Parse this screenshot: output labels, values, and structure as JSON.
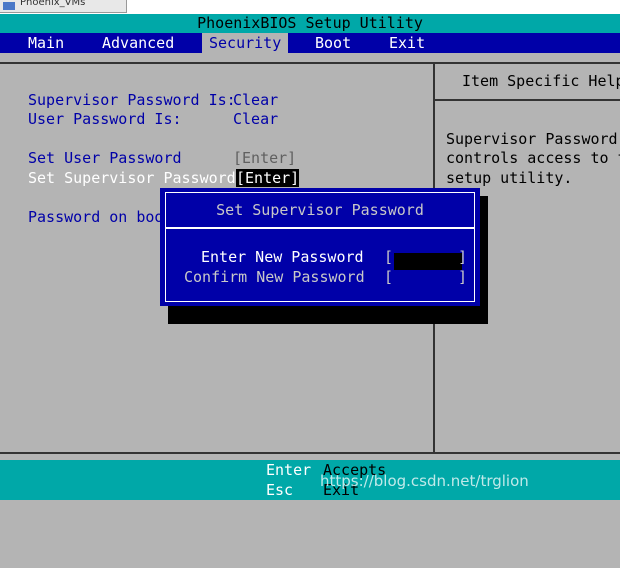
{
  "window": {
    "tab_title": "Phoenix_VMs"
  },
  "title": "PhoenixBIOS Setup Utility",
  "menu": [
    {
      "label": "Main"
    },
    {
      "label": "Advanced"
    },
    {
      "label": "Security",
      "active": true
    },
    {
      "label": "Boot"
    },
    {
      "label": "Exit"
    }
  ],
  "security": {
    "supervisor_pw_label": "Supervisor Password Is:",
    "supervisor_pw_value": "Clear",
    "user_pw_label": "User Password Is:",
    "user_pw_value": "Clear",
    "set_user_pw_label": "Set User Password",
    "set_user_pw_value": "[Enter]",
    "set_supervisor_pw_label": "Set Supervisor Password",
    "set_supervisor_pw_value": "[Enter]",
    "password_on_boot_label": "Password on boot"
  },
  "help": {
    "title": "Item Specific Help",
    "lines": [
      "Supervisor Password",
      "controls access to the",
      "setup utility."
    ]
  },
  "dialog": {
    "title": "Set Supervisor Password",
    "new_pw_label": "Enter New Password",
    "confirm_pw_label": "Confirm New Password",
    "bracket_open": "[",
    "bracket_close": "]"
  },
  "footer": {
    "key_enter": "Enter",
    "action_accept": "Accepts",
    "key_esc": "Esc",
    "action_exit": "Exit",
    "watermark": "https://blog.csdn.net/trglion"
  },
  "colors": {
    "bios_blue": "#0000a8",
    "bios_cyan": "#00a8a8",
    "bios_gray": "#b4b4b4",
    "highlight": "#000000"
  }
}
